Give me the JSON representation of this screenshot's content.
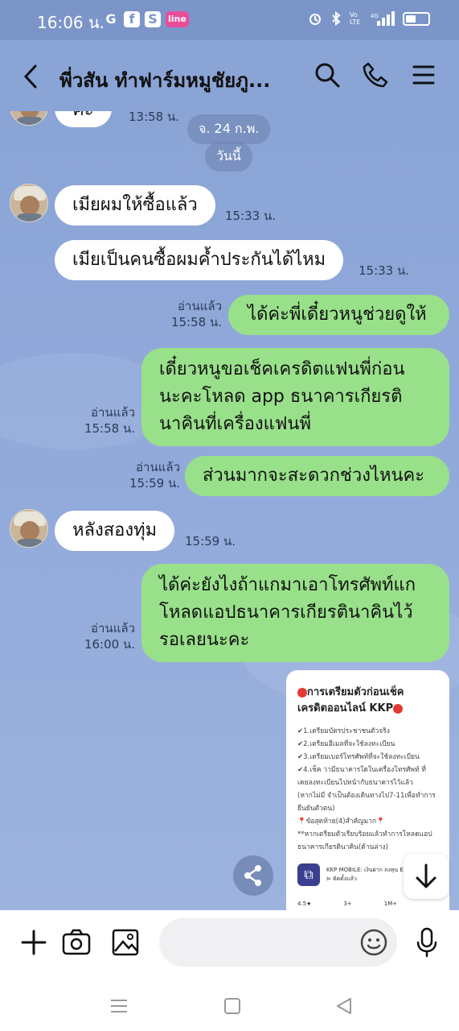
{
  "status_bar": {
    "time": "16:06 น.",
    "left_icons": [
      "G",
      "f",
      "S",
      "line"
    ],
    "right_icons": [
      "alarm",
      "bluetooth",
      "Vo LTE",
      "4G signal",
      "battery"
    ]
  },
  "header": {
    "title": "พี่วสัน ทำฟาร์มหมูชัยภู...",
    "icons": [
      "back-icon",
      "search-icon",
      "phone-icon",
      "menu-icon"
    ]
  },
  "chat": {
    "partial_top": {
      "text": "ค่ะ",
      "time": "13:58 น."
    },
    "date_pill": "จ. 24 ก.พ.",
    "today_pill": "วันนี้",
    "messages": [
      {
        "side": "in",
        "text": "เมียผมให้ซื้อแล้ว",
        "time": "15:33 น."
      },
      {
        "side": "in",
        "text": "เมียเป็นคนซื้อผมค้ำประกันได้ไหม",
        "time": "15:33 น."
      },
      {
        "side": "out",
        "text": "ได้ค่ะพี่เดี๋ยวหนูช่วยดูให้",
        "read": "อ่านแล้ว",
        "time": "15:58 น."
      },
      {
        "side": "out",
        "lines": [
          "เดี๋ยวหนูขอเช็คเครดิตแฟนพี่ก่อน",
          "นะคะโหลด app ธนาคารเกียรติ",
          "นาคินที่เครื่องแฟนพี่"
        ],
        "read": "อ่านแล้ว",
        "time": "15:58 น."
      },
      {
        "side": "out",
        "text": "ส่วนมากจะสะดวกช่วงไหนคะ",
        "read": "อ่านแล้ว",
        "time": "15:59 น."
      },
      {
        "side": "in",
        "text": "หลังสองทุ่ม",
        "time": "15:59 น."
      },
      {
        "side": "out",
        "lines": [
          "ได้ค่ะยังไงถ้าแกมาเอาโทรศัพท์แก",
          "โหลดแอปธนาคารเกียรตินาคินไว้",
          "รอเลยนะคะ"
        ],
        "read": "อ่านแล้ว",
        "time": "16:00 น."
      }
    ],
    "image_card": {
      "title_line1": "การเตรียมตัวก่อนเช็ค",
      "title_line2": "เครดิตออนไลน์ KKP",
      "lines": [
        "✔1.เตรียมบัตรประชาชนตัวจริง",
        "✔2.เตรียมอีเมลที่จะใช้ลงทะเบียน",
        "✔3.เตรียมเบอร์โทรศัพท์ที่จะใช้ลงทะเบียน",
        "✔4.เช็ค ว่ามีธนาคารใดในเครื่องโทรศัพท์ ที่",
        "เคยลงทะเบียนไปหน้ากับธนาคารไว้แล้ว",
        "(หากไม่มี จำเป็นต้องเดินทางไป7-11เพื่อทำการ",
        "ยืนยันตัวตน)",
        "📍ข้อสุดท้าย(4)สำคัญมาก📍",
        "**หากเตรียมตัวเรียบร้อยแล้วทำการโหลดแอป",
        "ธนาคารเกียรตินาคิน(ด้านล่าง)"
      ],
      "app_name": "KKP MOBILE: เงินฝาก ลงทุน ED",
      "app_sub": "⊳ ติดตั้งแล้ว",
      "stats": [
        "4.5★",
        "3+",
        "1M+"
      ]
    }
  },
  "composer": {
    "placeholder": ""
  }
}
